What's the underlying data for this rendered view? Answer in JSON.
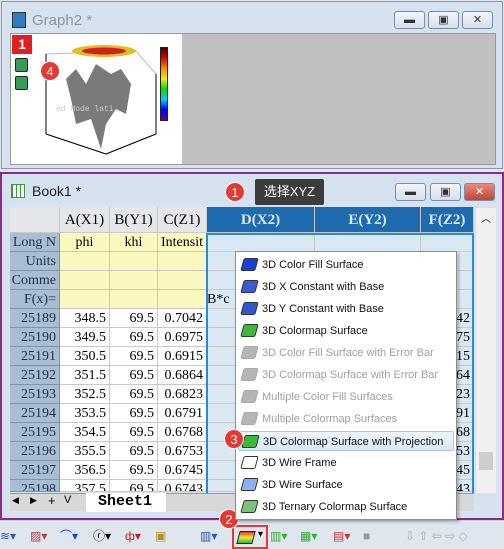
{
  "graph_window": {
    "title": "Graph2 *",
    "layer_number": "1",
    "buttons": [
      "minimize",
      "restore",
      "close"
    ],
    "thumbnail_watermark": "ed Mode lati"
  },
  "book_window": {
    "title": "Book1 *",
    "tooltip": "选择XYZ"
  },
  "badges": {
    "b1": "1",
    "b2": "2",
    "b3": "3",
    "b4": "4"
  },
  "worksheet": {
    "columns": [
      "A(X1)",
      "B(Y1)",
      "C(Z1)",
      "D(X2)",
      "E(Y2)",
      "F(Z2)"
    ],
    "meta_rows": [
      {
        "label": "Long N",
        "values": [
          "phi",
          "khi",
          "Intensit",
          "",
          "",
          ""
        ]
      },
      {
        "label": "Units",
        "values": [
          "",
          "",
          "",
          "",
          "",
          ""
        ]
      },
      {
        "label": "Comme",
        "values": [
          "",
          "",
          "",
          "",
          "",
          ""
        ]
      },
      {
        "label": "F(x)=",
        "values": [
          "",
          "",
          "",
          "B*c",
          "",
          ""
        ]
      }
    ],
    "rows": [
      {
        "id": "25189",
        "a": "348.5",
        "b": "69.5",
        "c": "0.7042",
        "f": "42"
      },
      {
        "id": "25190",
        "a": "349.5",
        "b": "69.5",
        "c": "0.6975",
        "f": "75"
      },
      {
        "id": "25191",
        "a": "350.5",
        "b": "69.5",
        "c": "0.6915",
        "f": "15"
      },
      {
        "id": "25192",
        "a": "351.5",
        "b": "69.5",
        "c": "0.6864",
        "f": "64"
      },
      {
        "id": "25193",
        "a": "352.5",
        "b": "69.5",
        "c": "0.6823",
        "f": "23"
      },
      {
        "id": "25194",
        "a": "353.5",
        "b": "69.5",
        "c": "0.6791",
        "f": "91"
      },
      {
        "id": "25195",
        "a": "354.5",
        "b": "69.5",
        "c": "0.6768",
        "f": "68"
      },
      {
        "id": "25196",
        "a": "355.5",
        "b": "69.5",
        "c": "0.6753",
        "f": "53"
      },
      {
        "id": "25197",
        "a": "356.5",
        "b": "69.5",
        "c": "0.6745",
        "f": "45"
      },
      {
        "id": "25198",
        "a": "357.5",
        "b": "69.5",
        "c": "0.6743",
        "f": "43"
      }
    ],
    "sheet_tab": "Sheet1"
  },
  "menu": {
    "items": [
      {
        "label": "3D Color Fill Surface",
        "enabled": true,
        "color": "#1a3fd8"
      },
      {
        "label": "3D X Constant with Base",
        "enabled": true,
        "color": "#3a5ad8"
      },
      {
        "label": "3D Y Constant with Base",
        "enabled": true,
        "color": "#2f58d0"
      },
      {
        "label": "3D Colormap Surface",
        "enabled": true,
        "color": "#3cb83c"
      },
      {
        "label": "3D Color Fill Surface with Error Bar",
        "enabled": false,
        "color": "#b5b5b5"
      },
      {
        "label": "3D Colormap Surface with Error Bar",
        "enabled": false,
        "color": "#b5b5b5"
      },
      {
        "label": "Multiple Color Fill Surfaces",
        "enabled": false,
        "color": "#b5b5b5"
      },
      {
        "label": "Multiple Colormap Surfaces",
        "enabled": false,
        "color": "#b5b5b5"
      },
      {
        "label": "3D Colormap Surface with Projection",
        "enabled": true,
        "highlighted": true,
        "color": "#3cb83c"
      },
      {
        "label": "3D Wire Frame",
        "enabled": true,
        "color": "#ffffff"
      },
      {
        "label": "3D Wire Surface",
        "enabled": true,
        "color": "#8fb0f0"
      },
      {
        "label": "3D Ternary Colormap Surface",
        "enabled": true,
        "color": "#7ac27a"
      }
    ]
  },
  "colors": {
    "selection": "#1e6bb0",
    "badge": "#e53935",
    "window_border": "#8b2a8b"
  }
}
